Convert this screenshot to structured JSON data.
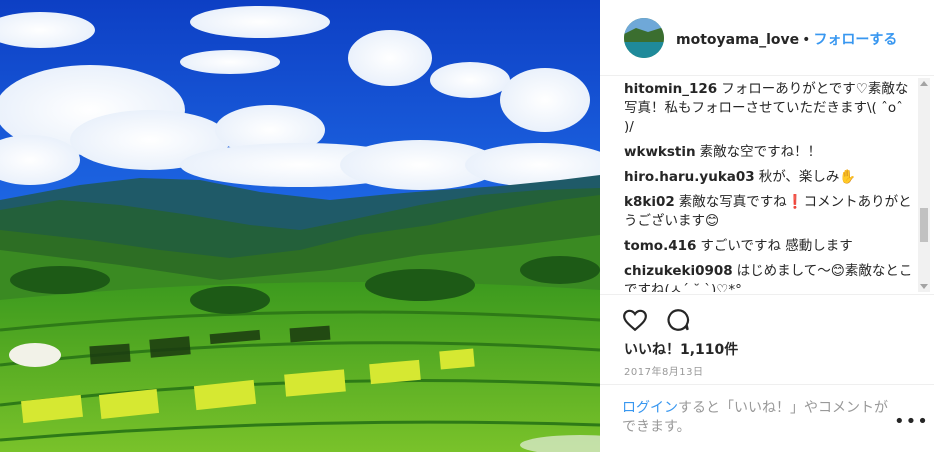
{
  "post": {
    "photo_alt": "",
    "username": "motoyama_love",
    "separator": "•",
    "follow_label": "フォローする"
  },
  "comments": [
    {
      "user": "hitomin_126",
      "text": "フォローありがとです♡素敵な写真！私もフォローさせていただきます\\( ˆoˆ )/"
    },
    {
      "user": "wkwkstin",
      "text": "素敵な空ですね！！"
    },
    {
      "user": "hiro.haru.yuka03",
      "text": "秋が、楽しみ✋"
    },
    {
      "user": "k8ki02",
      "text": "素敵な写真ですね❗コメントありがとうございます😊"
    },
    {
      "user": "tomo.416",
      "text": "すごいですね 感動します"
    },
    {
      "user": "chizukeki0908",
      "text": "はじめまして〜😊素敵なとこですね(ㅅ´ ˘ `)♡*°"
    }
  ],
  "actions": {
    "like_icon": "heart-icon",
    "comment_icon": "comment-bubble-icon",
    "likes_label": "いいね！",
    "likes_count": "1,110件",
    "date": "2017年8月13日"
  },
  "login": {
    "link_label": "ログイン",
    "text": "すると「いいね！」やコメントができます。",
    "more_label": "•••"
  }
}
